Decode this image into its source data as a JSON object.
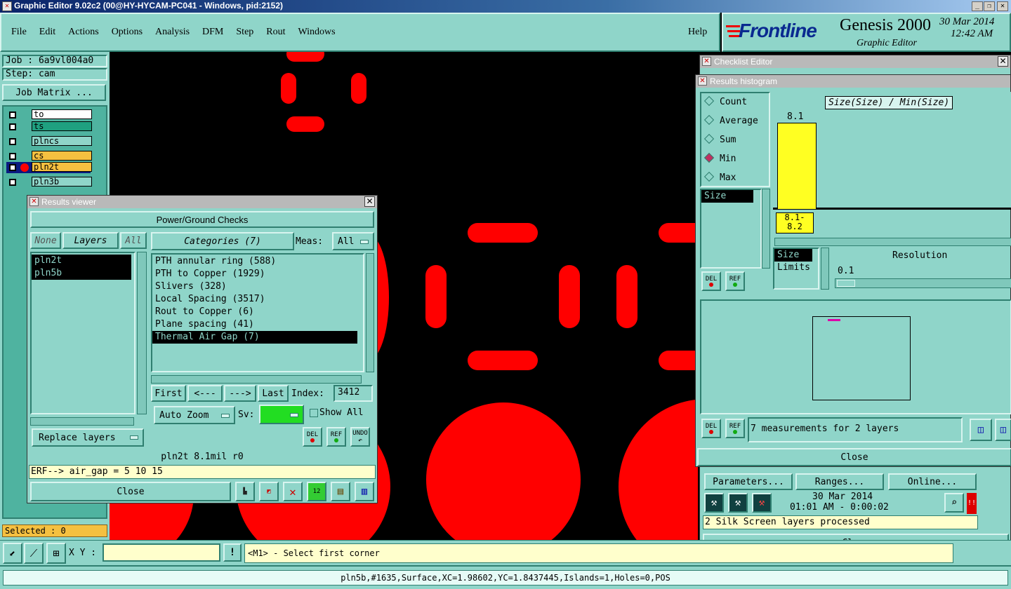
{
  "window": {
    "title": "Graphic Editor 9.02c2 (00@HY-HYCAM-PC041 - Windows, pid:2152)"
  },
  "menu": [
    "File",
    "Edit",
    "Actions",
    "Options",
    "Analysis",
    "DFM",
    "Step",
    "Rout",
    "Windows"
  ],
  "help": "Help",
  "brand": {
    "logo": "Frontline",
    "product": "Genesis 2000",
    "sub": "Graphic Editor",
    "date": "30 Mar 2014",
    "time": "12:42 AM"
  },
  "left": {
    "job": "Job : 6a9vl004a0",
    "step": "Step: cam",
    "job_matrix": "Job Matrix ...",
    "layers": [
      "to",
      "ts",
      "plncs",
      "cs",
      "pln2t",
      "pln3b"
    ],
    "selected": "Selected : 0"
  },
  "results_viewer": {
    "title": "Results viewer",
    "header": "Power/Ground Checks",
    "none": "None",
    "layers_label": "Layers",
    "all": "All",
    "categories_label": "Categories (7)",
    "meas_label": "Meas:",
    "meas_value": "All",
    "layer_list": [
      "pln2t",
      "pln5b"
    ],
    "categories": [
      "PTH annular ring (588)",
      "PTH to Copper (1929)",
      "Slivers (328)",
      "Local Spacing (3517)",
      "Rout to Copper (6)",
      "Plane spacing (41)",
      "Thermal Air Gap (7)"
    ],
    "selected_category": 6,
    "nav": {
      "first": "First",
      "prev": "<---",
      "next": "--->",
      "last": "Last",
      "index_label": "Index:",
      "index_value": "3412"
    },
    "auto_zoom": "Auto Zoom",
    "sv_label": "Sv:",
    "show_all": "Show All",
    "replace_layers": "Replace layers",
    "del": "DEL",
    "ref": "REF",
    "undo": "UNDO",
    "status": "pln2t 8.1mil  r0",
    "erf": "ERF--> air_gap = 5 10 15",
    "close": "Close"
  },
  "checklist": {
    "title": "Checklist Editor",
    "parameters": "Parameters...",
    "ranges": "Ranges...",
    "online": "Online...",
    "date": "30 Mar 2014",
    "timerange": "01:01 AM - 0:00:02",
    "message": "2 Silk Screen layers processed",
    "close": "Close"
  },
  "histogram": {
    "title": "Results histogram",
    "modes": [
      "Count",
      "Average",
      "Sum",
      "Min",
      "Max"
    ],
    "selected_mode": 3,
    "list_item": "Size",
    "chart_title": "Size(Size) / Min(Size)",
    "bar_value": "8.1",
    "bar_label_1": "8.1-",
    "bar_label_2": "8.2",
    "size_item": "Size",
    "limits_item": "Limits",
    "resolution_label": "Resolution",
    "resolution_value": "0.1",
    "del": "DEL",
    "ref": "REF",
    "measurements": "7 measurements for 2 layers",
    "close": "Close"
  },
  "bottom": {
    "xy_label": "X Y :",
    "prompt": "<M1> - Select first corner",
    "status": "pln5b,#1635,Surface,XC=1.98602,YC=1.8437445,Islands=1,Holes=0,POS"
  },
  "colors": {
    "teal": "#8fd5c9",
    "pad_red": "#ff0000",
    "highlight_yellow": "#ffff22"
  }
}
